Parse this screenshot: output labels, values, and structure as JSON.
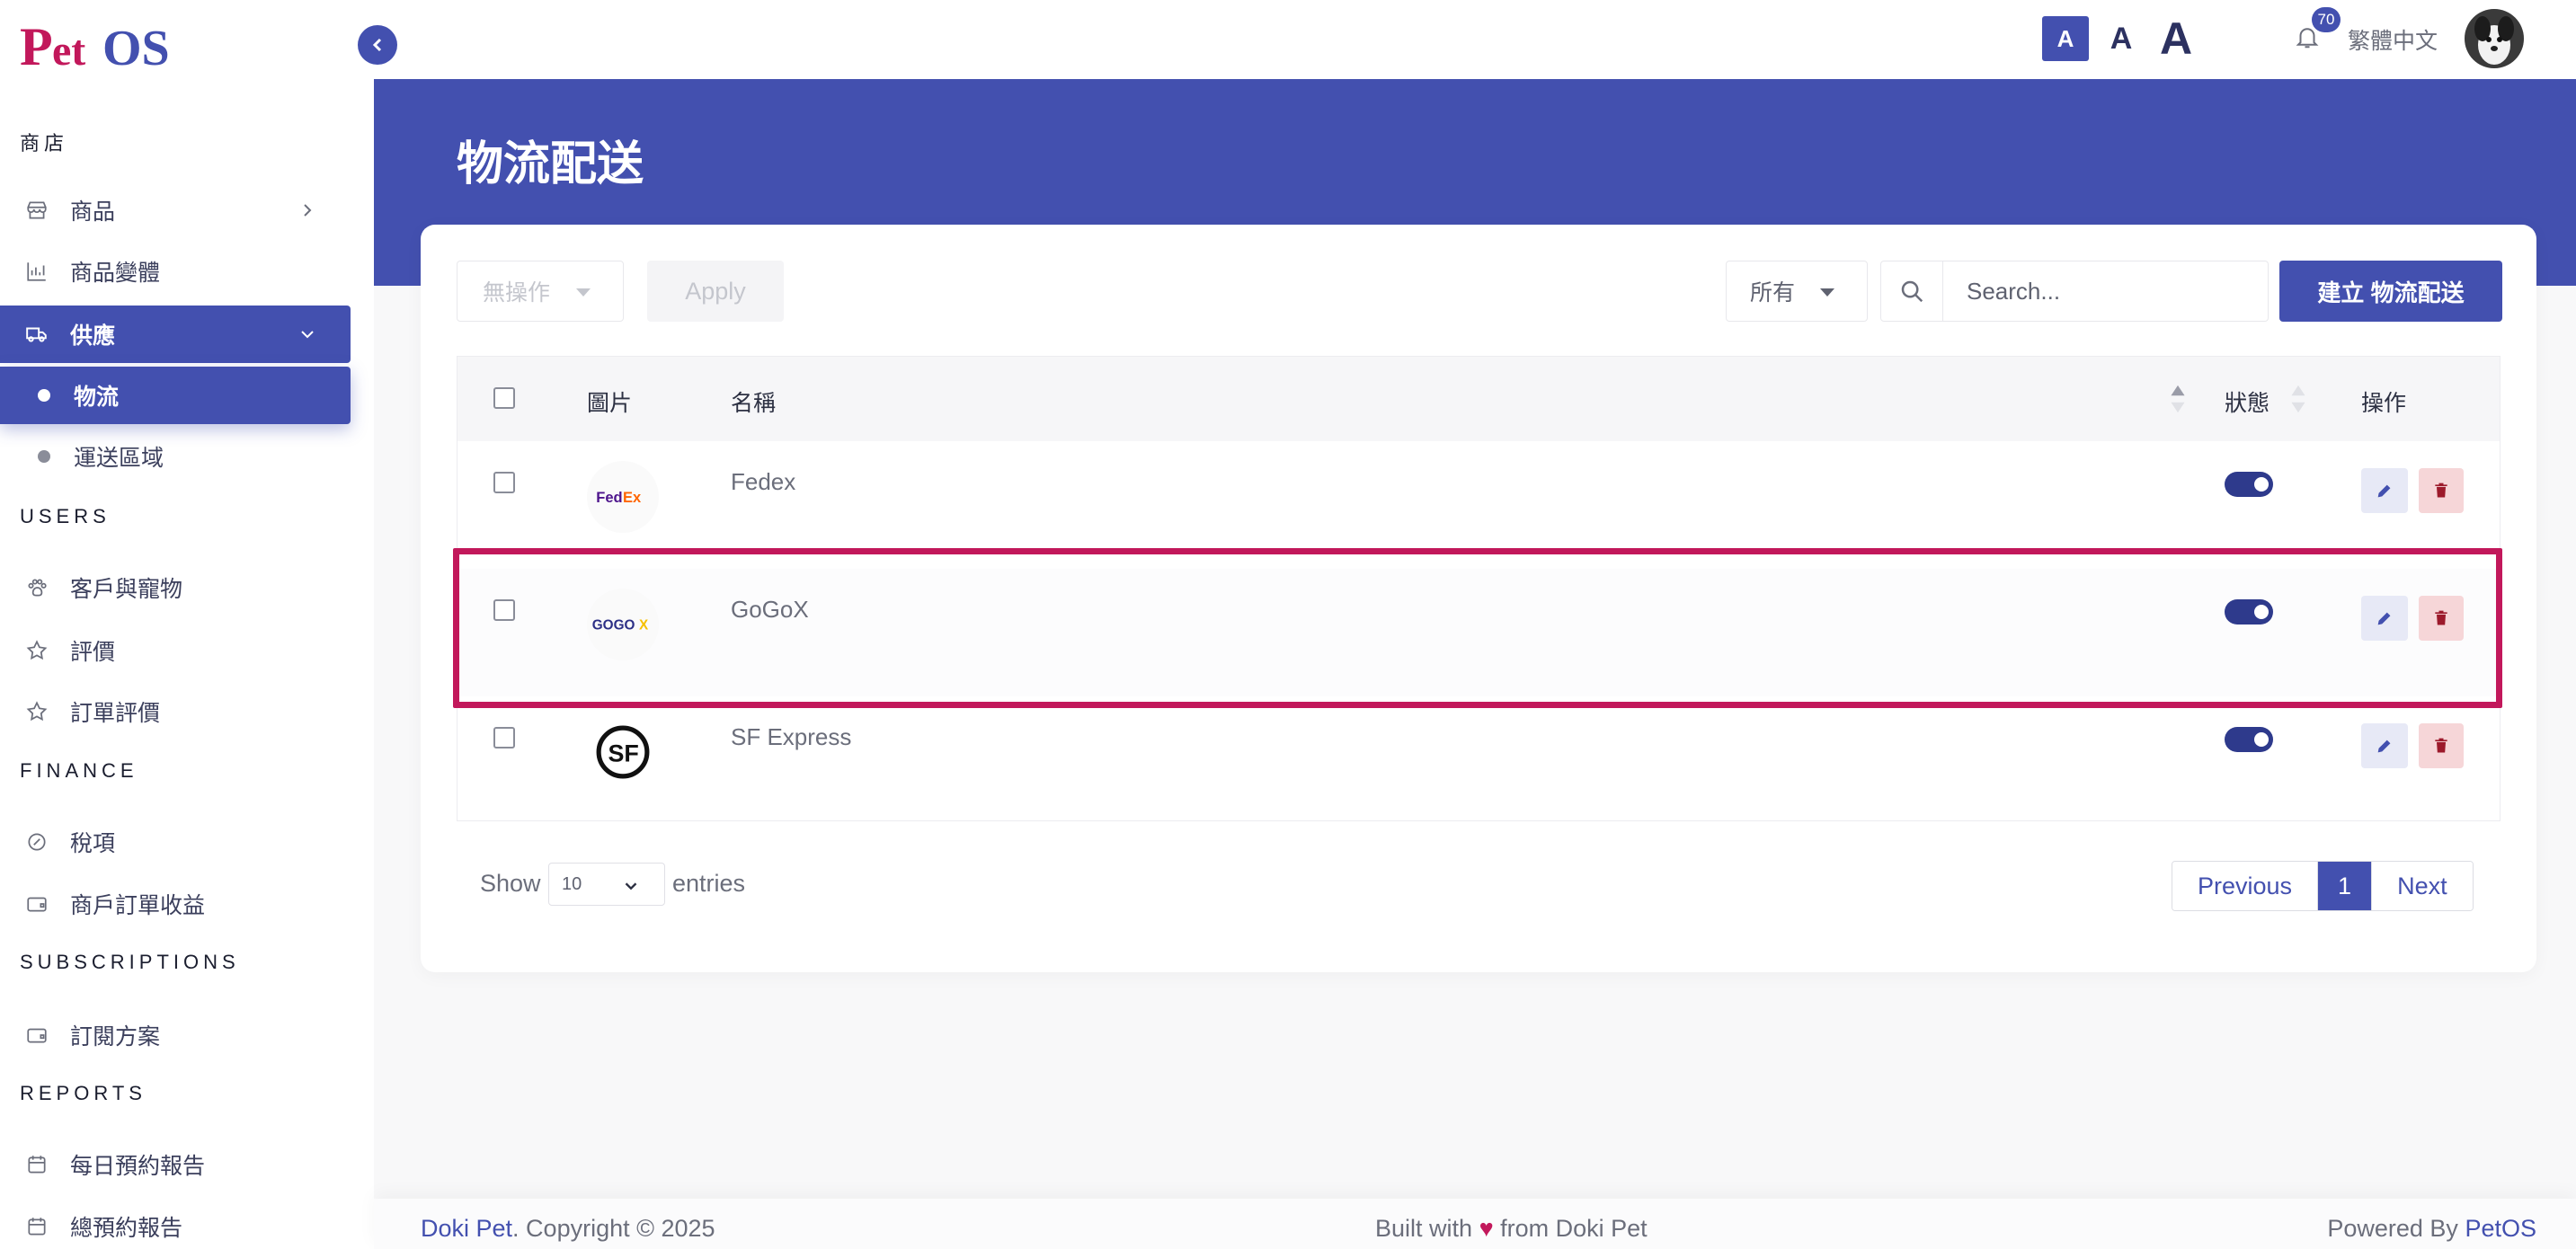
{
  "app": {
    "logo_text": "PetOS"
  },
  "sidebar": {
    "sections": [
      {
        "title": "商店"
      },
      {
        "title": "USERS"
      },
      {
        "title": "FINANCE"
      },
      {
        "title": "SUBSCRIPTIONS"
      },
      {
        "title": "REPORTS"
      }
    ],
    "items": [
      {
        "label": "商品",
        "icon": "store-icon"
      },
      {
        "label": "商品變體",
        "icon": "variants-icon"
      },
      {
        "label": "供應",
        "icon": "truck-icon",
        "active": true
      },
      {
        "label": "物流",
        "sub": true,
        "active": true
      },
      {
        "label": "運送區域",
        "sub": true
      },
      {
        "label": "客戶與寵物",
        "icon": "paw-icon"
      },
      {
        "label": "評價",
        "icon": "star-icon"
      },
      {
        "label": "訂單評價",
        "icon": "star-icon"
      },
      {
        "label": "稅項",
        "icon": "tax-icon"
      },
      {
        "label": "商戶訂單收益",
        "icon": "wallet-icon"
      },
      {
        "label": "訂閱方案",
        "icon": "wallet-icon"
      },
      {
        "label": "每日預約報告",
        "icon": "calendar-icon"
      },
      {
        "label": "總預約報告",
        "icon": "calendar-icon"
      }
    ]
  },
  "topbar": {
    "font_sizes": [
      "A",
      "A",
      "A"
    ],
    "notification_count": "70",
    "language": "繁體中文"
  },
  "page": {
    "title": "物流配送"
  },
  "toolbar": {
    "bulk_action": "無操作",
    "apply_label": "Apply",
    "filter_value": "所有",
    "search_placeholder": "Search...",
    "create_label": "建立 物流配送"
  },
  "table": {
    "headers": {
      "image": "圖片",
      "name": "名稱",
      "status": "狀態",
      "actions": "操作"
    },
    "rows": [
      {
        "name": "Fedex",
        "logo": "FedEx",
        "status": true
      },
      {
        "name": "GoGoX",
        "logo": "GOGOX",
        "status": true
      },
      {
        "name": "SF Express",
        "logo": "SF",
        "status": true
      }
    ]
  },
  "pagination": {
    "show_label": "Show",
    "page_length": "10",
    "entries_label": "entries",
    "previous": "Previous",
    "current": "1",
    "next": "Next"
  },
  "footer": {
    "company": "Doki Pet",
    "copyright": ". Copyright © 2025",
    "built_prefix": "Built with",
    "heart": "♥",
    "built_suffix": "from Doki Pet",
    "powered_prefix": "Powered By",
    "powered_brand": "PetOS"
  },
  "colors": {
    "primary": "#4350af",
    "highlight": "#c2185b",
    "danger_bg": "#f6d6d8"
  }
}
